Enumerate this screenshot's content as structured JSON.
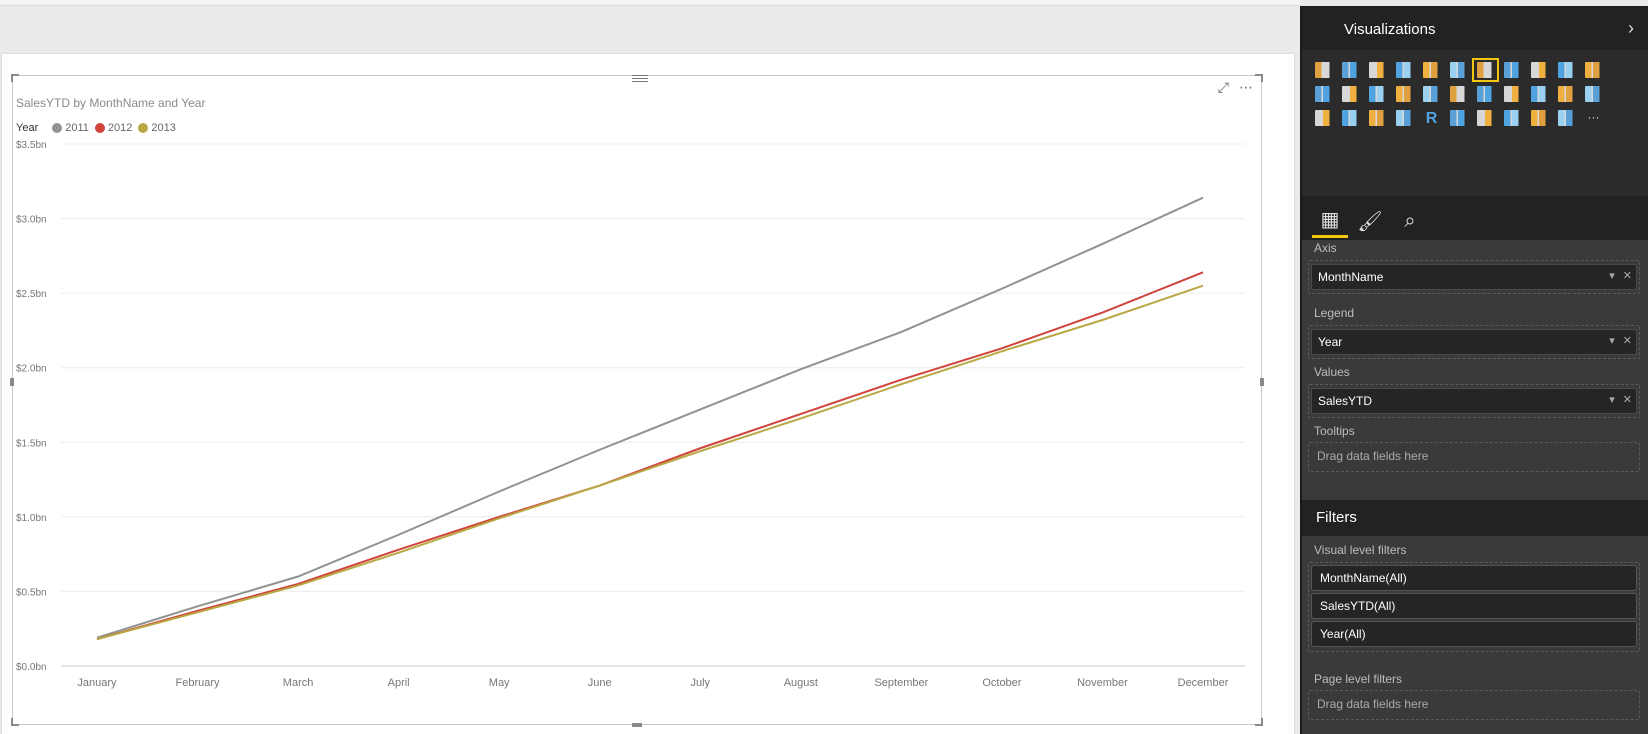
{
  "visual": {
    "title": "SalesYTD by MonthName and Year",
    "legend_title": "Year",
    "expand_icon": "focus-mode-icon",
    "more_icon": "more-options-icon"
  },
  "chart_data": {
    "type": "line",
    "title": "SalesYTD by MonthName and Year",
    "xlabel": "",
    "ylabel": "",
    "categories": [
      "January",
      "February",
      "March",
      "April",
      "May",
      "June",
      "July",
      "August",
      "September",
      "October",
      "November",
      "December"
    ],
    "y_ticks": [
      "$0.0bn",
      "$0.5bn",
      "$1.0bn",
      "$1.5bn",
      "$2.0bn",
      "$2.5bn",
      "$3.0bn",
      "$3.5bn"
    ],
    "ylim": [
      0,
      3.5
    ],
    "grid": true,
    "legend_position": "top-left",
    "series": [
      {
        "name": "2011",
        "color": "#8f948f",
        "values": [
          0.19,
          0.4,
          0.6,
          0.88,
          1.17,
          1.45,
          1.72,
          1.99,
          2.24,
          2.53,
          2.83,
          3.14
        ]
      },
      {
        "name": "2012",
        "color": "#d0443b",
        "values": [
          0.18,
          0.37,
          0.55,
          0.78,
          1.0,
          1.21,
          1.46,
          1.69,
          1.92,
          2.13,
          2.37,
          2.64
        ]
      },
      {
        "name": "2013",
        "color": "#b8a944",
        "values": [
          0.18,
          0.36,
          0.54,
          0.76,
          0.99,
          1.21,
          1.44,
          1.66,
          1.89,
          2.11,
          2.32,
          2.55
        ]
      }
    ]
  },
  "panel": {
    "title": "Visualizations",
    "chevron_icon": "chevron-right-icon",
    "tabs": [
      "fields-icon",
      "format-paint-roller-icon",
      "analytics-icon"
    ],
    "wells": {
      "axis_label": "Axis",
      "axis_value": "MonthName",
      "legend_label": "Legend",
      "legend_value": "Year",
      "values_label": "Values",
      "values_value": "SalesYTD",
      "tooltips_label": "Tooltips",
      "tooltips_placeholder": "Drag data fields here"
    },
    "filters": {
      "title": "Filters",
      "visual_level_label": "Visual level filters",
      "items": [
        "MonthName(All)",
        "SalesYTD(All)",
        "Year(All)"
      ],
      "page_level_label": "Page level filters",
      "page_placeholder": "Drag data fields here"
    },
    "viz_icons": [
      [
        "stacked-bar-icon",
        "stacked-column-icon",
        "clustered-bar-icon",
        "clustered-column-icon",
        "100-stacked-bar-icon",
        "100-stacked-column-icon",
        "line-chart-icon",
        "area-chart-icon",
        "stacked-area-icon",
        "line-clustered-column-icon",
        "line-stacked-column-icon"
      ],
      [
        "ribbon-chart-icon",
        "scatter-chart-icon",
        "pie-chart-icon",
        "treemap-icon",
        "map-icon",
        "table-icon",
        "matrix-icon",
        "filled-map-icon",
        "funnel-icon",
        "gauge-icon",
        "multi-row-card-icon"
      ],
      [
        "card-icon",
        "kpi-icon",
        "slicer-icon",
        "donut-chart-icon",
        "r-script-icon",
        "shape-map-icon",
        "table-visual-icon",
        "matrix-visual-icon",
        "image-icon",
        "globe-icon",
        "more-visuals-icon"
      ]
    ],
    "selected_viz": "line-chart-icon"
  }
}
